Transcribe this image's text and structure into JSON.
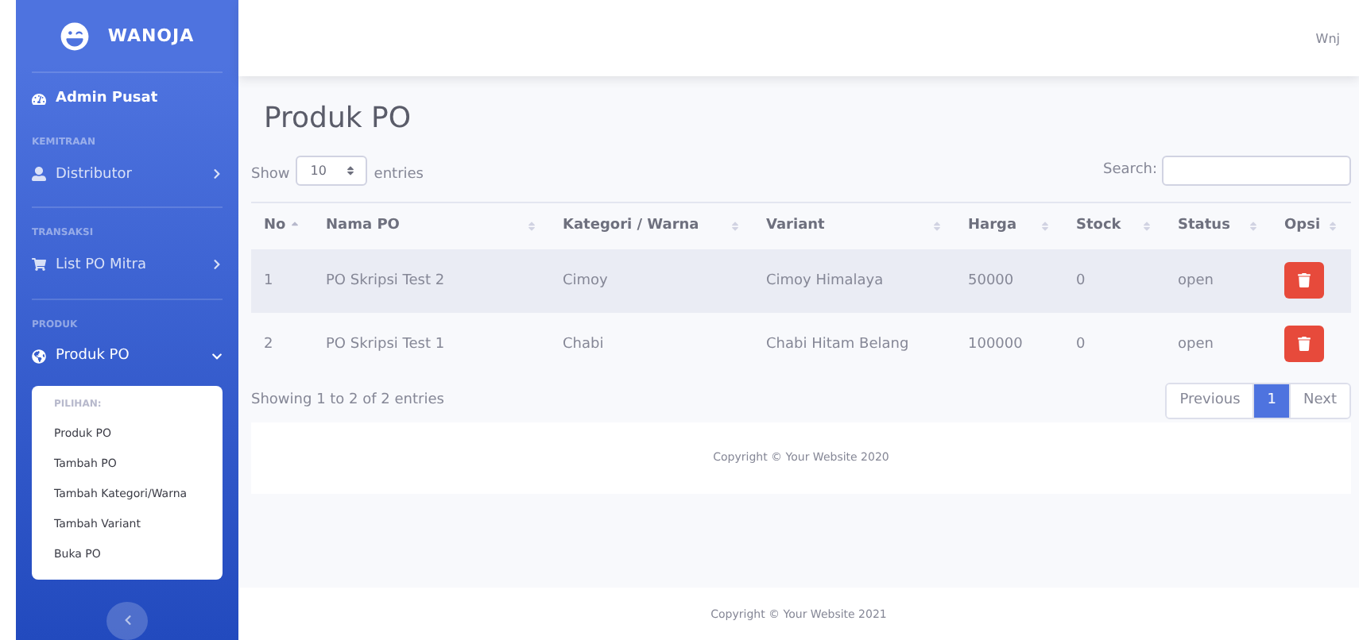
{
  "sidebar": {
    "brand": "WANOJA",
    "dashboard": {
      "label": "Admin Pusat"
    },
    "sections": [
      {
        "heading": "KEMITRAAN",
        "items": [
          {
            "label": "Distributor",
            "expanded": false
          }
        ]
      },
      {
        "heading": "TRANSAKSI",
        "items": [
          {
            "label": "List PO Mitra",
            "expanded": false
          }
        ]
      },
      {
        "heading": "PRODUK",
        "items": [
          {
            "label": "Produk PO",
            "expanded": true
          }
        ]
      }
    ],
    "submenu": {
      "heading": "PILIHAN:",
      "items": [
        "Produk PO",
        "Tambah PO",
        "Tambah Kategori/Warna",
        "Tambah Variant",
        "Buka PO"
      ]
    }
  },
  "topbar": {
    "user": "Wnj"
  },
  "page_title": "Produk PO",
  "length_control": {
    "before": "Show",
    "value": "10",
    "after": "entries"
  },
  "search": {
    "label": "Search:"
  },
  "table": {
    "columns": [
      "No",
      "Nama PO",
      "Kategori / Warna",
      "Variant",
      "Harga",
      "Stock",
      "Status",
      "Opsi"
    ],
    "rows": [
      [
        "1",
        "PO Skripsi Test 2",
        "Cimoy",
        "Cimoy Himalaya",
        "50000",
        "0",
        "open"
      ],
      [
        "2",
        "PO Skripsi Test 1",
        "Chabi",
        "Chabi Hitam Belang",
        "100000",
        "0",
        "open"
      ]
    ]
  },
  "info": "Showing 1 to 2 of 2 entries",
  "pagination": [
    {
      "label": "Previous",
      "selected": false
    },
    {
      "label": "1",
      "selected": true
    },
    {
      "label": "Next",
      "selected": false
    }
  ],
  "card_footer": "Copyright © Your Website 2020",
  "footer": "Copyright © Your Website 2021"
}
